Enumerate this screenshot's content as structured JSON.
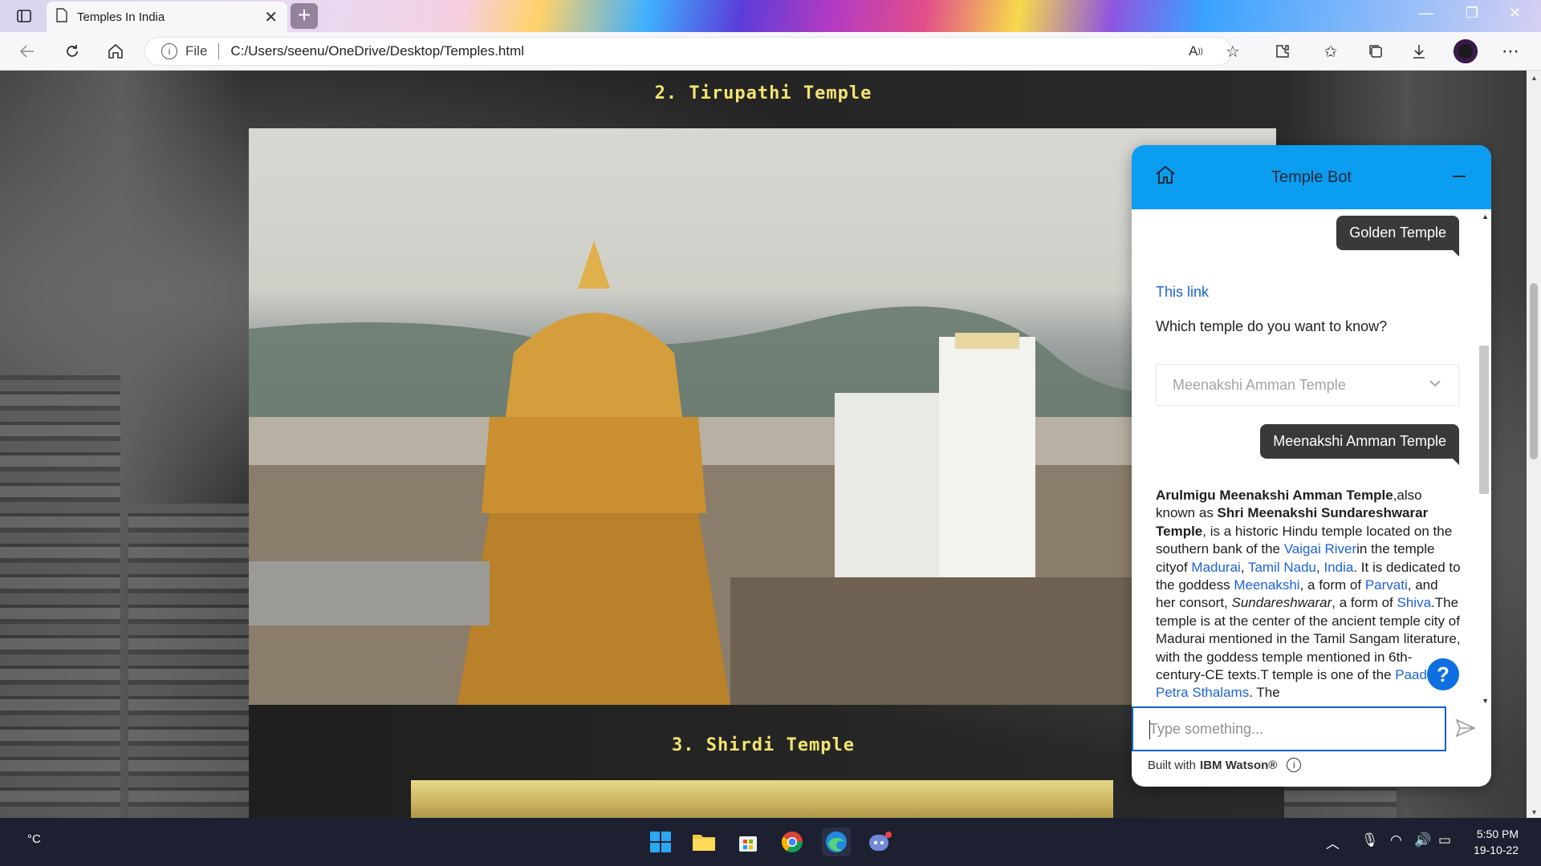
{
  "browser": {
    "tab_title": "Temples In India",
    "address_prefix": "File",
    "url": "C:/Users/seenu/OneDrive/Desktop/Temples.html"
  },
  "page": {
    "section2_title": "2. Tirupathi Temple",
    "section3_title": "3. Shirdi Temple"
  },
  "chat": {
    "title": "Temple Bot",
    "messages": {
      "user1": "Golden Temple",
      "bot_link": "This link",
      "bot_question": "Which temple do you want to know?",
      "dropdown_value": "Meenakshi Amman Temple",
      "user2": "Meenakshi Amman Temple"
    },
    "answer": {
      "b1": "Arulmigu Meenakshi Amman Temple",
      "t1": ",also known as ",
      "b2": "Shri Meenakshi Sundareshwarar Temple",
      "t2": ", is a historic Hindu temple located on the southern bank of the ",
      "l_vaigai": "Vaigai River",
      "t3": "in the temple cityof ",
      "l_madurai": "Madurai",
      "t4": ", ",
      "l_tamil": "Tamil Nadu",
      "t5": ", ",
      "l_india": "India",
      "t6": ". It is dedicated to the goddess ",
      "l_meenakshi": "Meenakshi",
      "t7": ", a form of ",
      "l_parvati": "Parvati",
      "t8": ", and her consort, ",
      "i1": "Sundareshwarar",
      "t9": ", a form of ",
      "l_shiva": "Shiva",
      "t10": ".The temple is at the center of the ancient temple city of Madurai mentioned in the Tamil Sangam literature, with the goddess temple mentioned in 6th-century-CE texts.T temple is one of the ",
      "l_paadal": "Paadal Petra Sthalams",
      "t11": ". The"
    },
    "input_placeholder": "Type something...",
    "footer_prefix": "Built with",
    "footer_brand": "IBM Watson®",
    "help_label": "?"
  },
  "taskbar": {
    "weather": "°C",
    "time": "5:50 PM",
    "date": "19-10-22"
  },
  "colors": {
    "chat_header": "#0b9df0",
    "title_yellow": "#f2e46f",
    "link_blue": "#1c63d9"
  }
}
